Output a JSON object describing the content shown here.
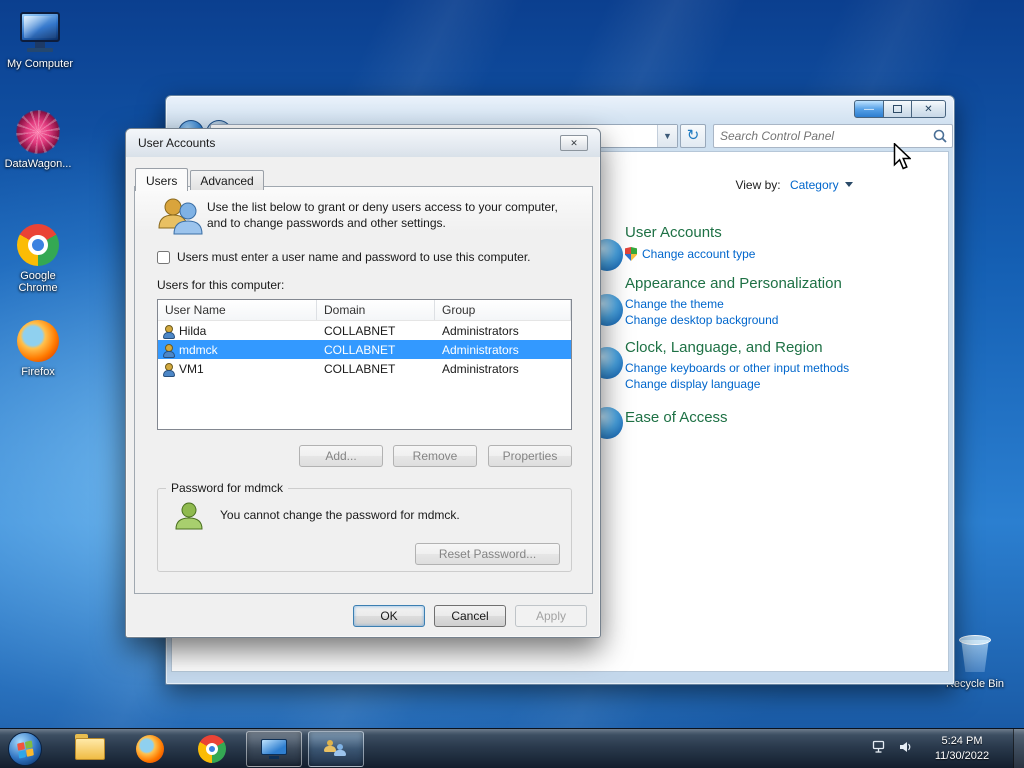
{
  "desktop": {
    "icons": {
      "my_computer": "My Computer",
      "datawagon": "DataWagon...",
      "chrome": "Google Chrome",
      "firefox": "Firefox",
      "recycle_bin": "Recycle Bin"
    }
  },
  "control_panel": {
    "search_placeholder": "Search Control Panel",
    "view_by_label": "View by:",
    "view_by_value": "Category",
    "sections": [
      {
        "title": "User Accounts",
        "links": [
          "Change account type"
        ]
      },
      {
        "title": "Appearance and Personalization",
        "links": [
          "Change the theme",
          "Change desktop background"
        ]
      },
      {
        "title": "Clock, Language, and Region",
        "links": [
          "Change keyboards or other input methods",
          "Change display language"
        ]
      },
      {
        "title": "Ease of Access",
        "links": []
      }
    ]
  },
  "dialog": {
    "title": "User Accounts",
    "tab_users": "Users",
    "tab_advanced": "Advanced",
    "intro": "Use the list below to grant or deny users access to your computer, and to change passwords and other settings.",
    "require_label": "Users must enter a user name and password to use this computer.",
    "list_caption": "Users for this computer:",
    "col_name": "User Name",
    "col_domain": "Domain",
    "col_group": "Group",
    "users": [
      {
        "name": "Hilda",
        "domain": "COLLABNET",
        "group": "Administrators"
      },
      {
        "name": "mdmck",
        "domain": "COLLABNET",
        "group": "Administrators"
      },
      {
        "name": "VM1",
        "domain": "COLLABNET",
        "group": "Administrators"
      }
    ],
    "selected_user": "mdmck",
    "btn_add": "Add...",
    "btn_remove": "Remove",
    "btn_properties": "Properties",
    "group_title": "Password for mdmck",
    "password_note": "You cannot change the password for mdmck.",
    "btn_reset": "Reset Password...",
    "btn_ok": "OK",
    "btn_cancel": "Cancel",
    "btn_apply": "Apply"
  },
  "taskbar": {
    "time": "5:24 PM",
    "date": "11/30/2022"
  },
  "colors": {
    "selection_blue": "#3399ff",
    "heading_green": "#1e7145",
    "link_blue": "#0066cc"
  }
}
